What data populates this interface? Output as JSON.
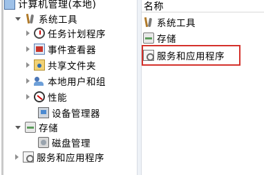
{
  "tree": {
    "root_label": "计算机管理(本地)",
    "items": [
      {
        "label": "系统工具",
        "icon": "tools-icon",
        "state": "expanded"
      },
      {
        "label": "任务计划程序",
        "icon": "task-scheduler-icon",
        "state": "collapsed"
      },
      {
        "label": "事件查看器",
        "icon": "event-viewer-icon",
        "state": "collapsed"
      },
      {
        "label": "共享文件夹",
        "icon": "shared-folder-icon",
        "state": "collapsed"
      },
      {
        "label": "本地用户和组",
        "icon": "users-icon",
        "state": "collapsed"
      },
      {
        "label": "性能",
        "icon": "performance-icon",
        "state": "collapsed"
      },
      {
        "label": "设备管理器",
        "icon": "device-manager-icon",
        "state": "none"
      },
      {
        "label": "存储",
        "icon": "storage-icon",
        "state": "expanded"
      },
      {
        "label": "磁盘管理",
        "icon": "disk-icon",
        "state": "none"
      },
      {
        "label": "服务和应用程序",
        "icon": "services-icon",
        "state": "collapsed"
      }
    ]
  },
  "list": {
    "column_header": "名称",
    "items": [
      {
        "label": "系统工具",
        "icon": "tools-icon"
      },
      {
        "label": "存储",
        "icon": "storage-icon"
      },
      {
        "label": "服务和应用程序",
        "icon": "services-icon",
        "highlighted": true
      }
    ]
  },
  "colors": {
    "highlight_border": "#d4302a"
  }
}
